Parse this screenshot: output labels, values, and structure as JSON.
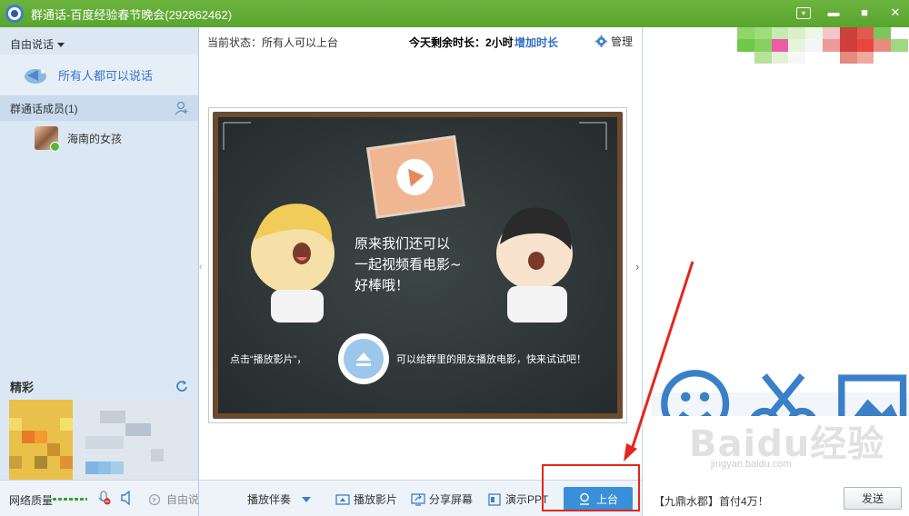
{
  "window": {
    "title": "群通话-百度经验春节晚会(292862462)"
  },
  "left": {
    "mode_label": "自由说话",
    "everyone_label": "所有人都可以说话",
    "members_header": "群通话成员(1)",
    "members": [
      {
        "name": "海南的女孩"
      }
    ],
    "wonder_title": "精彩"
  },
  "center": {
    "status": "当前状态：所有人可以上台",
    "remaining": "今天剩余时长：2小时",
    "add_time": "增加时长",
    "manage": "管理",
    "board": {
      "caption_lines": [
        "原来我们还可以",
        "一起视频看电影~",
        "好棒哦！"
      ],
      "hint_left": "点击“播放影片”，",
      "hint_right": "可以给群里的朋友播放电影，快来试试吧！"
    }
  },
  "toolbar": {
    "network_quality": "网络质量",
    "free_talk": "自由说话",
    "play_companion": "播放伴奏",
    "play_movie": "播放影片",
    "share_screen": "分享屏幕",
    "present_ppt": "演示PPT",
    "on_stage": "上台"
  },
  "right": {
    "message": "【九鼎水郡】首付4万！",
    "send": "发送"
  },
  "watermark": {
    "logo": "Baidu经验",
    "url": "jingyan.baidu.com"
  },
  "colors": {
    "titlebar": "#5fac34",
    "accent_blue": "#3a90d8",
    "highlight_red": "#e5261c"
  }
}
